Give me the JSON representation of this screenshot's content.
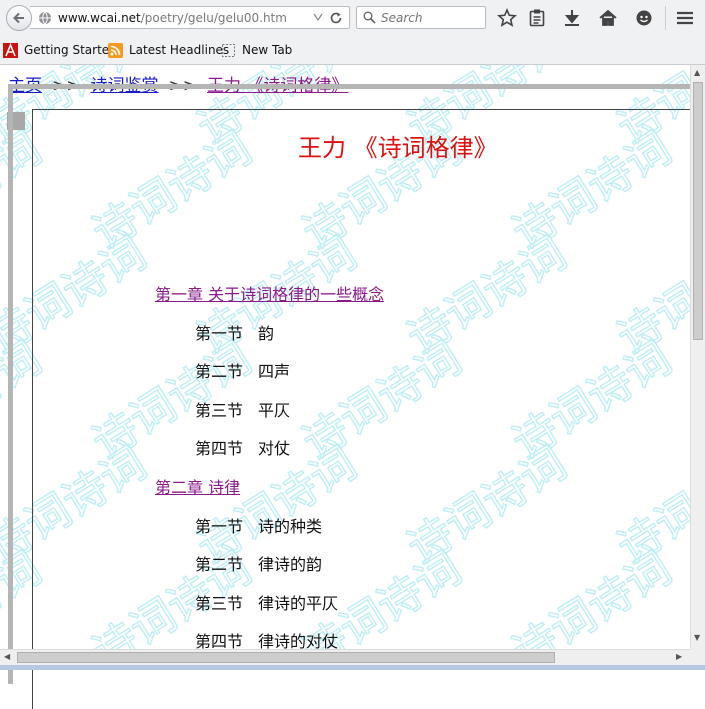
{
  "browser": {
    "url_host": "www.wcai.net",
    "url_path": "/poetry/gelu/gelu00.htm",
    "search_placeholder": "Search",
    "bookmarks": [
      "Getting Started",
      "Latest Headlines",
      "New Tab"
    ]
  },
  "page": {
    "breadcrumb": {
      "home": "主页",
      "sep1": ">>",
      "appreciation": "诗词鉴赏",
      "sep2": ">>",
      "current": "王力 《诗词格律》"
    },
    "title": "王力 《诗词格律》",
    "watermark_text": "诗词诗词",
    "toc": [
      {
        "type": "chapter",
        "label": "第一章  关于诗词格律的一些概念"
      },
      {
        "type": "section",
        "num": "第一节",
        "label": "韵"
      },
      {
        "type": "section",
        "num": "第二节",
        "label": "四声"
      },
      {
        "type": "section",
        "num": "第三节",
        "label": "平仄"
      },
      {
        "type": "section",
        "num": "第四节",
        "label": "对仗"
      },
      {
        "type": "chapter",
        "label": "第二章  诗律"
      },
      {
        "type": "section",
        "num": "第一节",
        "label": "诗的种类"
      },
      {
        "type": "section",
        "num": "第二节",
        "label": "律诗的韵"
      },
      {
        "type": "section",
        "num": "第三节",
        "label": "律诗的平仄"
      },
      {
        "type": "section",
        "num": "第四节",
        "label": "律诗的对仗"
      }
    ]
  },
  "colors": {
    "link_blue": "#1a1acc",
    "visited_purple": "#8a1a8a",
    "title_red": "#dd1111",
    "watermark_cyan": "#bfeef5"
  }
}
